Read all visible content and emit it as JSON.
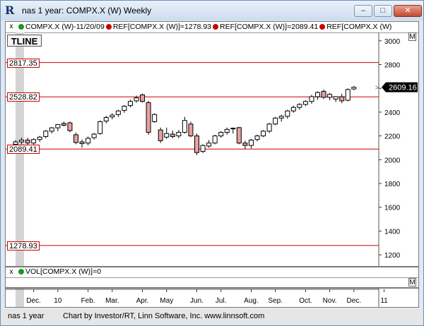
{
  "window": {
    "title": "nas 1 year: COMPX.X (W) Weekly",
    "minimize_label": "–",
    "maximize_label": "□",
    "close_label": "✕"
  },
  "legend": {
    "close_marker": "x",
    "symbol_label": "COMPX.X (W)-11/20/09",
    "items": [
      {
        "label": "REF[COMPX.X (W)]=1278.93",
        "color": "#cc0000"
      },
      {
        "label": "REF[COMPX.X (W)]=2089.41",
        "color": "#cc0000"
      },
      {
        "label": "REF[COMPX.X (W)",
        "color": "#cc0000"
      }
    ],
    "m_label": "M"
  },
  "tline_label": "TLINE",
  "volume": {
    "close_marker": "x",
    "label": "VOL[COMPX.X (W)]=0",
    "m_label": "M"
  },
  "status_bar": {
    "left": "nas 1 year",
    "center": "Chart by Investor/RT, Linn Software, Inc. www.linnsoft.com"
  },
  "colors": {
    "ref_line": "#cc0000",
    "down_candle": "#e8a0a0",
    "up_candle": "#ffffff",
    "last_price_bg": "#000000",
    "cursor_band": "#d4d4d4"
  },
  "chart_data": {
    "type": "candlestick",
    "symbol": "COMPX.X (W)",
    "interval": "Weekly",
    "ylim": [
      1100,
      3070
    ],
    "yticks": [
      1200,
      1400,
      1600,
      1800,
      2000,
      2200,
      2400,
      2600,
      2800,
      3000
    ],
    "xtick_labels": [
      "Dec.",
      "10",
      "Feb.",
      "Mar.",
      "Apr.",
      "May",
      "Jun.",
      "Jul.",
      "Aug.",
      "Sep.",
      "Oct.",
      "Nov.",
      "Dec.",
      "11"
    ],
    "xtick_index": [
      3,
      7,
      12,
      16,
      21,
      25,
      30,
      34,
      39,
      43,
      48,
      52,
      56,
      61
    ],
    "reference_lines": [
      {
        "label": "2817.35",
        "value": 2817.35
      },
      {
        "label": "2528.82",
        "value": 2528.82
      },
      {
        "label": "2089.41",
        "value": 2089.41
      },
      {
        "label": "1278.93",
        "value": 1278.93
      }
    ],
    "last_price": "2609.16",
    "last_value": 2609.16,
    "candles": [
      {
        "open": 2130,
        "high": 2165,
        "low": 2110,
        "close": 2150
      },
      {
        "open": 2150,
        "high": 2185,
        "low": 2130,
        "close": 2165
      },
      {
        "open": 2165,
        "high": 2185,
        "low": 2115,
        "close": 2140
      },
      {
        "open": 2140,
        "high": 2180,
        "low": 2120,
        "close": 2170
      },
      {
        "open": 2170,
        "high": 2200,
        "low": 2150,
        "close": 2190
      },
      {
        "open": 2195,
        "high": 2250,
        "low": 2180,
        "close": 2240
      },
      {
        "open": 2240,
        "high": 2275,
        "low": 2220,
        "close": 2268
      },
      {
        "open": 2268,
        "high": 2300,
        "low": 2240,
        "close": 2295
      },
      {
        "open": 2305,
        "high": 2320,
        "low": 2280,
        "close": 2290
      },
      {
        "open": 2310,
        "high": 2320,
        "low": 2230,
        "close": 2245
      },
      {
        "open": 2210,
        "high": 2230,
        "low": 2130,
        "close": 2145
      },
      {
        "open": 2150,
        "high": 2170,
        "low": 2100,
        "close": 2135
      },
      {
        "open": 2140,
        "high": 2195,
        "low": 2120,
        "close": 2180
      },
      {
        "open": 2185,
        "high": 2225,
        "low": 2170,
        "close": 2215
      },
      {
        "open": 2220,
        "high": 2330,
        "low": 2210,
        "close": 2320
      },
      {
        "open": 2325,
        "high": 2370,
        "low": 2305,
        "close": 2355
      },
      {
        "open": 2360,
        "high": 2390,
        "low": 2340,
        "close": 2375
      },
      {
        "open": 2380,
        "high": 2420,
        "low": 2360,
        "close": 2410
      },
      {
        "open": 2415,
        "high": 2460,
        "low": 2395,
        "close": 2450
      },
      {
        "open": 2455,
        "high": 2505,
        "low": 2440,
        "close": 2490
      },
      {
        "open": 2495,
        "high": 2540,
        "low": 2480,
        "close": 2520
      },
      {
        "open": 2545,
        "high": 2555,
        "low": 2480,
        "close": 2490
      },
      {
        "open": 2480,
        "high": 2495,
        "low": 2210,
        "close": 2230
      },
      {
        "open": 2320,
        "high": 2390,
        "low": 2310,
        "close": 2380
      },
      {
        "open": 2250,
        "high": 2270,
        "low": 2140,
        "close": 2160
      },
      {
        "open": 2190,
        "high": 2270,
        "low": 2175,
        "close": 2220
      },
      {
        "open": 2215,
        "high": 2245,
        "low": 2180,
        "close": 2195
      },
      {
        "open": 2200,
        "high": 2250,
        "low": 2180,
        "close": 2230
      },
      {
        "open": 2230,
        "high": 2360,
        "low": 2220,
        "close": 2330
      },
      {
        "open": 2300,
        "high": 2320,
        "low": 2190,
        "close": 2200
      },
      {
        "open": 2200,
        "high": 2220,
        "low": 2040,
        "close": 2060
      },
      {
        "open": 2070,
        "high": 2130,
        "low": 2055,
        "close": 2120
      },
      {
        "open": 2115,
        "high": 2165,
        "low": 2100,
        "close": 2140
      },
      {
        "open": 2140,
        "high": 2210,
        "low": 2130,
        "close": 2200
      },
      {
        "open": 2200,
        "high": 2240,
        "low": 2185,
        "close": 2230
      },
      {
        "open": 2230,
        "high": 2270,
        "low": 2210,
        "close": 2255
      },
      {
        "open": 2265,
        "high": 2270,
        "low": 2220,
        "close": 2260
      },
      {
        "open": 2270,
        "high": 2275,
        "low": 2130,
        "close": 2140
      },
      {
        "open": 2140,
        "high": 2160,
        "low": 2090,
        "close": 2120
      },
      {
        "open": 2120,
        "high": 2175,
        "low": 2095,
        "close": 2165
      },
      {
        "open": 2170,
        "high": 2210,
        "low": 2155,
        "close": 2200
      },
      {
        "open": 2200,
        "high": 2250,
        "low": 2190,
        "close": 2240
      },
      {
        "open": 2240,
        "high": 2310,
        "low": 2225,
        "close": 2300
      },
      {
        "open": 2300,
        "high": 2360,
        "low": 2290,
        "close": 2350
      },
      {
        "open": 2350,
        "high": 2380,
        "low": 2320,
        "close": 2365
      },
      {
        "open": 2365,
        "high": 2420,
        "low": 2345,
        "close": 2410
      },
      {
        "open": 2410,
        "high": 2455,
        "low": 2395,
        "close": 2440
      },
      {
        "open": 2440,
        "high": 2475,
        "low": 2420,
        "close": 2465
      },
      {
        "open": 2465,
        "high": 2500,
        "low": 2450,
        "close": 2490
      },
      {
        "open": 2490,
        "high": 2545,
        "low": 2470,
        "close": 2530
      },
      {
        "open": 2530,
        "high": 2575,
        "low": 2505,
        "close": 2565
      },
      {
        "open": 2575,
        "high": 2590,
        "low": 2510,
        "close": 2525
      },
      {
        "open": 2525,
        "high": 2560,
        "low": 2500,
        "close": 2550
      },
      {
        "open": 2510,
        "high": 2535,
        "low": 2485,
        "close": 2530
      },
      {
        "open": 2530,
        "high": 2555,
        "low": 2475,
        "close": 2495
      },
      {
        "open": 2500,
        "high": 2600,
        "low": 2490,
        "close": 2590
      },
      {
        "open": 2595,
        "high": 2620,
        "low": 2585,
        "close": 2609.16
      }
    ]
  }
}
